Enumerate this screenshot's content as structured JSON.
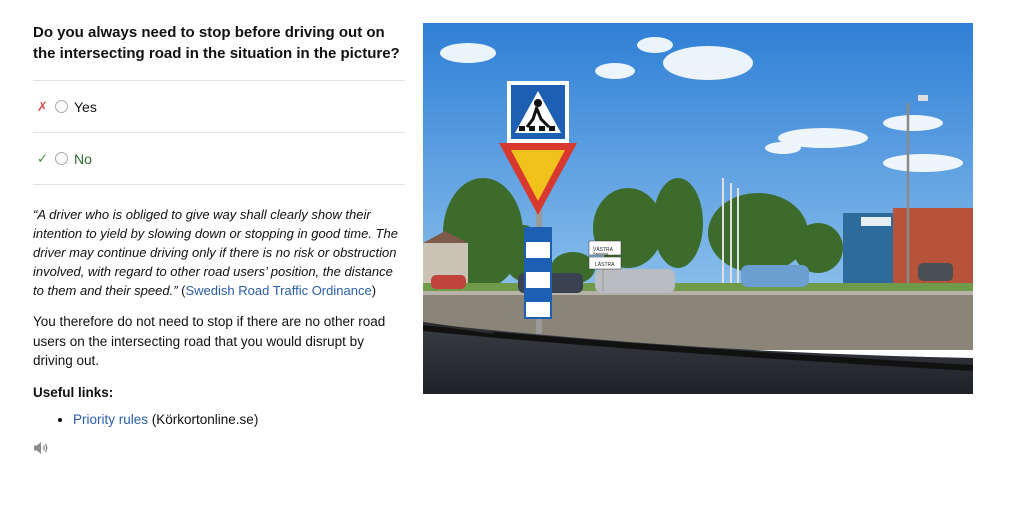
{
  "question": "Do you always need to stop before driving out on the intersecting road in the situation in the picture?",
  "answers": [
    {
      "label": "Yes",
      "mark": "✗"
    },
    {
      "label": "No",
      "mark": "✓"
    }
  ],
  "explanation": {
    "quote": "“A driver who is obliged to give way shall clearly show their intention to yield by slowing down or stopping in good time. The driver may continue driving only if there is no risk or obstruction involved, with regard to other road users’ position, the distance to them and their speed.”",
    "open_paren": " (",
    "source_link": "Swedish Road Traffic Ordinance",
    "close_paren": ")",
    "paragraph": "You therefore do not need to stop if there are no other road users on the intersecting road that you would disrupt by driving out."
  },
  "useful_links": {
    "title": "Useful links:",
    "items": [
      {
        "link_text": "Priority rules",
        "suffix": " (Körkortonline.se)"
      }
    ]
  },
  "photo": {
    "sign_text_1": "VÄSTRA",
    "sign_text_2": "Parkering",
    "sign_text_3": "LÄSTRA"
  },
  "icons": {
    "speaker": "speaker-icon"
  },
  "colors": {
    "link": "#2a5ea8",
    "wrong": "#d9534f",
    "correct": "#3b8a3b"
  }
}
